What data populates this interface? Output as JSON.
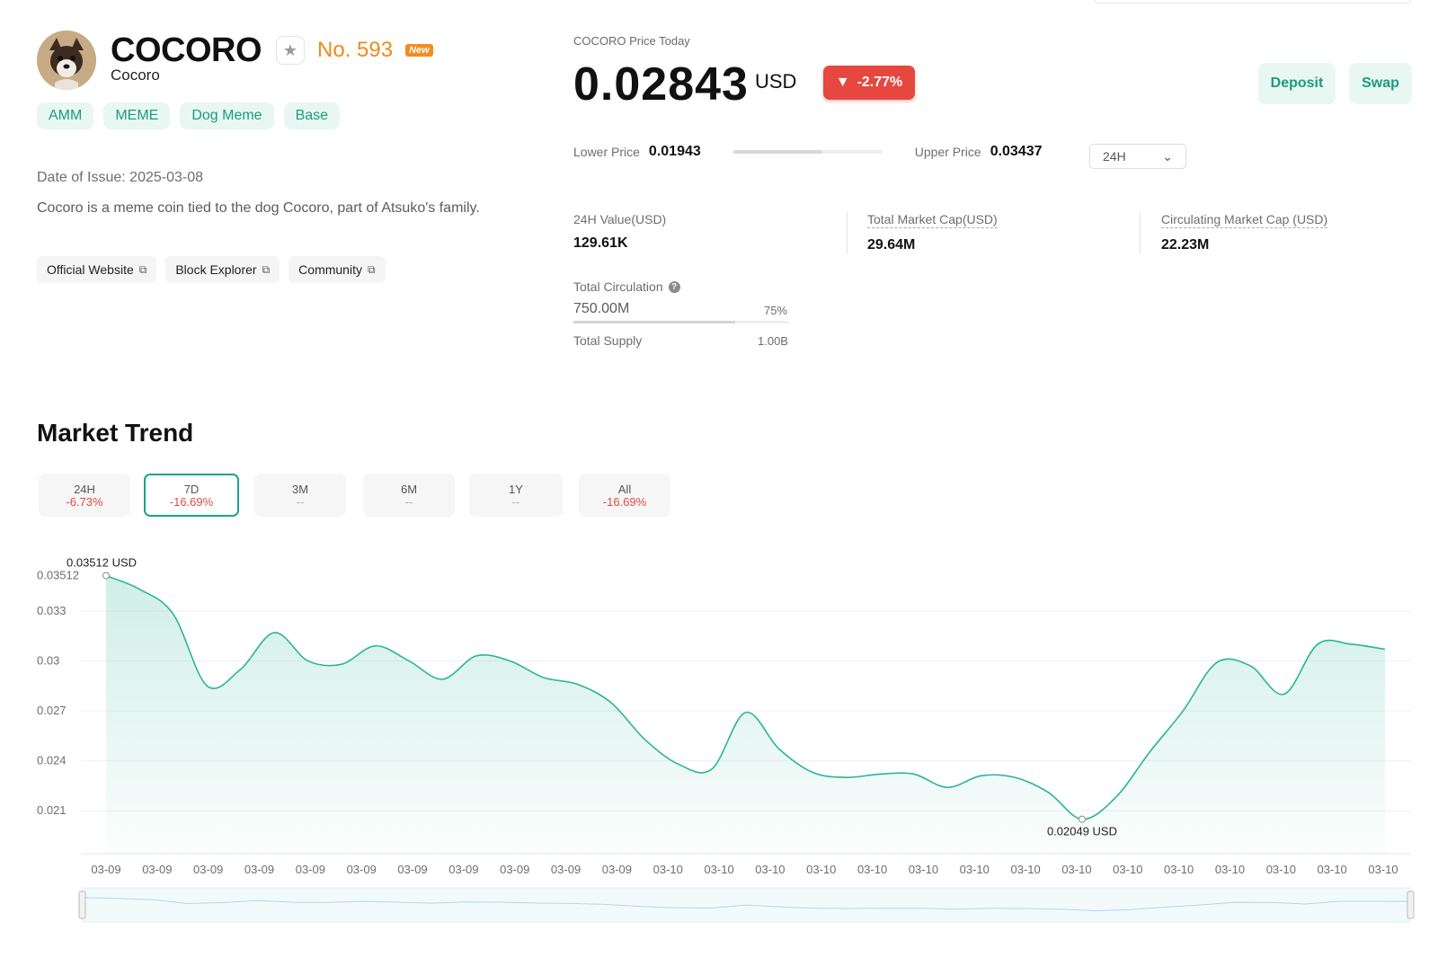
{
  "token": {
    "symbol": "COCORO",
    "name": "Cocoro",
    "rank": "No. 593",
    "new_badge": "New",
    "tags": [
      "AMM",
      "MEME",
      "Dog Meme",
      "Base"
    ],
    "issue_date": "Date of Issue: 2025-03-08",
    "description": "Cocoro is a meme coin tied to the dog Cocoro, part of Atsuko's family.",
    "links": [
      "Official Website",
      "Block Explorer",
      "Community"
    ]
  },
  "price": {
    "label": "COCORO Price Today",
    "value": "0.02843",
    "unit": "USD",
    "change": "-2.77%",
    "deposit_label": "Deposit",
    "swap_label": "Swap",
    "lower_label": "Lower Price",
    "lower_value": "0.01943",
    "upper_label": "Upper Price",
    "upper_value": "0.03437",
    "range_position": 0.6,
    "period": "24H"
  },
  "stats": [
    {
      "label": "24H Value(USD)",
      "value": "129.61K"
    },
    {
      "label": "Total Market Cap(USD)",
      "value": "29.64M"
    },
    {
      "label": "Circulating Market Cap (USD)",
      "value": "22.23M"
    }
  ],
  "circulation": {
    "label": "Total Circulation",
    "value": "750.00M",
    "percent": "75%",
    "fraction": 0.75,
    "supply_label": "Total Supply",
    "supply_value": "1.00B"
  },
  "trend": {
    "title": "Market Trend",
    "tabs": [
      {
        "label": "24H",
        "change": "-6.73%",
        "active": false
      },
      {
        "label": "7D",
        "change": "-16.69%",
        "active": true
      },
      {
        "label": "3M",
        "change": "--",
        "active": false
      },
      {
        "label": "6M",
        "change": "--",
        "active": false
      },
      {
        "label": "1Y",
        "change": "--",
        "active": false
      },
      {
        "label": "All",
        "change": "-16.69%",
        "active": false
      }
    ]
  },
  "chart_data": {
    "type": "area",
    "y_ticks": [
      "0.03512",
      "0.033",
      "0.03",
      "0.027",
      "0.024",
      "0.021"
    ],
    "y_tick_values": [
      0.03512,
      0.033,
      0.03,
      0.027,
      0.024,
      0.021
    ],
    "ylim": [
      0.0195,
      0.0358
    ],
    "x_ticks": [
      "03-09",
      "03-09",
      "03-09",
      "03-09",
      "03-09",
      "03-09",
      "03-09",
      "03-09",
      "03-09",
      "03-09",
      "03-09",
      "03-10",
      "03-10",
      "03-10",
      "03-10",
      "03-10",
      "03-10",
      "03-10",
      "03-10",
      "03-10",
      "03-10",
      "03-10",
      "03-10",
      "03-10",
      "03-10",
      "03-10"
    ],
    "values": [
      0.03512,
      0.0343,
      0.0328,
      0.0285,
      0.0295,
      0.0317,
      0.03,
      0.0298,
      0.0309,
      0.03,
      0.0289,
      0.0303,
      0.03,
      0.029,
      0.0286,
      0.0275,
      0.0253,
      0.0238,
      0.0235,
      0.0269,
      0.0247,
      0.0233,
      0.023,
      0.0232,
      0.0232,
      0.0224,
      0.0231,
      0.023,
      0.0221,
      0.02049,
      0.0218,
      0.0245,
      0.027,
      0.0299,
      0.0297,
      0.028,
      0.031,
      0.031,
      0.0307
    ],
    "max_label": "0.03512 USD",
    "min_label": "0.02049 USD",
    "max_index": 0,
    "min_index": 29,
    "grid": true,
    "colors": {
      "line": "#2bb592",
      "fill": "#e8f7f2"
    }
  }
}
